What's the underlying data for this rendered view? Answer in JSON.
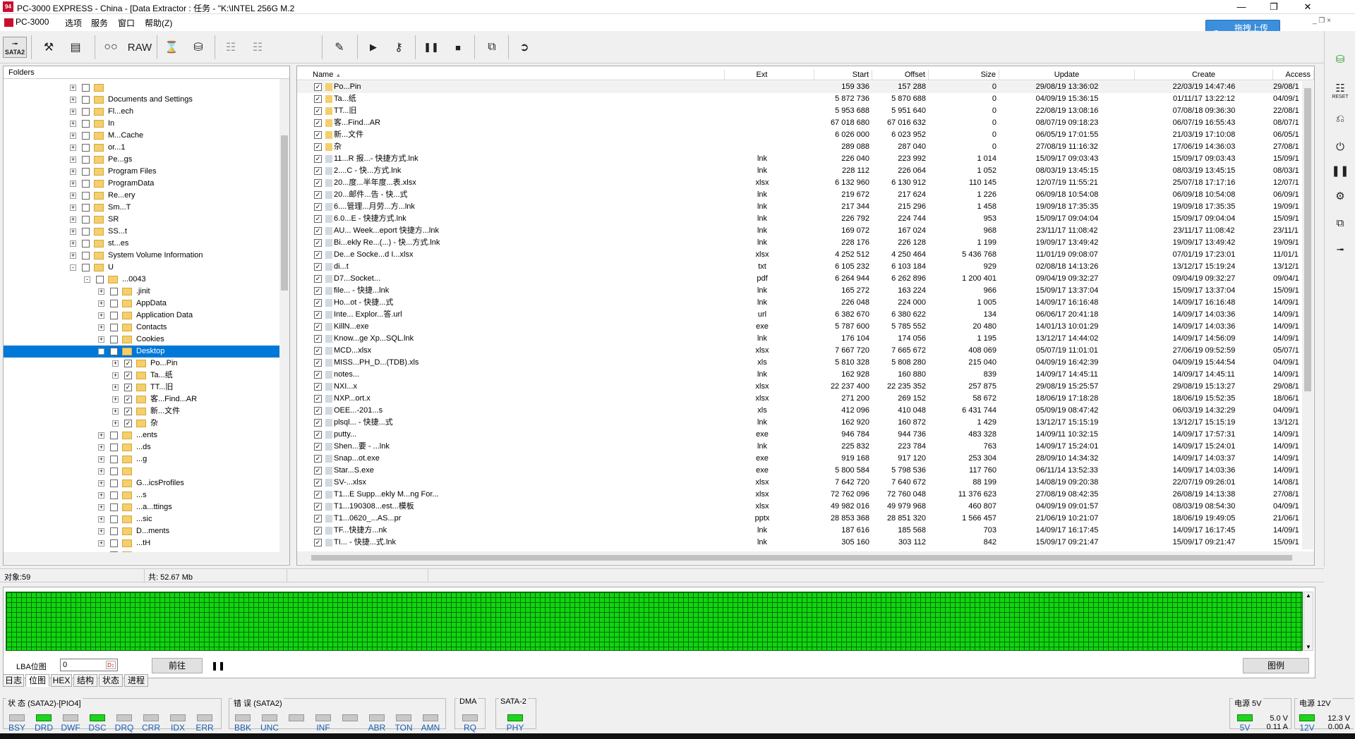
{
  "title": "PC-3000 EXPRESS - China - [Data Extractor : 任务 - \"K:\\INTEL 256G M.2",
  "app_icon_text": "94",
  "menu": [
    "PC-3000",
    "选项",
    "服务",
    "窗口",
    "帮助(Z)"
  ],
  "toolbar": {
    "sata_label": "SATA2",
    "raw_label": "RAW"
  },
  "upload": {
    "label": "拖拽上传"
  },
  "folders": {
    "header": "Folders",
    "rows": [
      {
        "depth": 0,
        "label": "",
        "checked": false,
        "expand": "+"
      },
      {
        "depth": 0,
        "label": "Documents and Settings",
        "checked": false,
        "expand": "+"
      },
      {
        "depth": 0,
        "label": "Fl...ech",
        "checked": false,
        "expand": "+"
      },
      {
        "depth": 0,
        "label": "In",
        "checked": false,
        "expand": "+"
      },
      {
        "depth": 0,
        "label": "M...Cache",
        "checked": false,
        "expand": "+"
      },
      {
        "depth": 0,
        "label": "or...1",
        "checked": false,
        "expand": "+"
      },
      {
        "depth": 0,
        "label": "Pe...gs",
        "checked": false,
        "expand": "+"
      },
      {
        "depth": 0,
        "label": "Program Files",
        "checked": false,
        "expand": "+"
      },
      {
        "depth": 0,
        "label": "ProgramData",
        "checked": false,
        "expand": "+"
      },
      {
        "depth": 0,
        "label": "Re...ery",
        "checked": false,
        "expand": "+"
      },
      {
        "depth": 0,
        "label": "Sm...T",
        "checked": false,
        "expand": "+"
      },
      {
        "depth": 0,
        "label": "SR",
        "checked": false,
        "expand": "+"
      },
      {
        "depth": 0,
        "label": "SS...t",
        "checked": false,
        "expand": "+"
      },
      {
        "depth": 0,
        "label": "st...es",
        "checked": false,
        "expand": "+"
      },
      {
        "depth": 0,
        "label": "System Volume Information",
        "checked": false,
        "expand": "+"
      },
      {
        "depth": 0,
        "label": "U",
        "checked": false,
        "expand": "-"
      },
      {
        "depth": 1,
        "label": "...0043",
        "checked": false,
        "expand": "-"
      },
      {
        "depth": 2,
        "label": ".jinit",
        "checked": false,
        "expand": "+"
      },
      {
        "depth": 2,
        "label": "AppData",
        "checked": false,
        "expand": "+"
      },
      {
        "depth": 2,
        "label": "Application Data",
        "checked": false,
        "expand": "+"
      },
      {
        "depth": 2,
        "label": "Contacts",
        "checked": false,
        "expand": "+"
      },
      {
        "depth": 2,
        "label": "Cookies",
        "checked": false,
        "expand": "+"
      },
      {
        "depth": 2,
        "label": "Desktop",
        "checked": true,
        "expand": "-",
        "selected": true
      },
      {
        "depth": 3,
        "label": "Po...Pin",
        "checked": true,
        "expand": "+"
      },
      {
        "depth": 3,
        "label": "Ta...纸",
        "checked": true,
        "expand": "+"
      },
      {
        "depth": 3,
        "label": "TT...旧",
        "checked": true,
        "expand": "+"
      },
      {
        "depth": 3,
        "label": "客...Find...AR",
        "checked": true,
        "expand": "+"
      },
      {
        "depth": 3,
        "label": "新...文件",
        "checked": true,
        "expand": "+"
      },
      {
        "depth": 3,
        "label": "杂",
        "checked": true,
        "expand": "+"
      },
      {
        "depth": 2,
        "label": "...ents",
        "checked": false,
        "expand": "+"
      },
      {
        "depth": 2,
        "label": "...ds",
        "checked": false,
        "expand": "+"
      },
      {
        "depth": 2,
        "label": "...g",
        "checked": false,
        "expand": "+"
      },
      {
        "depth": 2,
        "label": "",
        "checked": false,
        "expand": "+"
      },
      {
        "depth": 2,
        "label": "G...icsProfiles",
        "checked": false,
        "expand": "+"
      },
      {
        "depth": 2,
        "label": "...s",
        "checked": false,
        "expand": "+"
      },
      {
        "depth": 2,
        "label": "...a...ttings",
        "checked": false,
        "expand": "+"
      },
      {
        "depth": 2,
        "label": "...sic",
        "checked": false,
        "expand": "+"
      },
      {
        "depth": 2,
        "label": "D...ments",
        "checked": false,
        "expand": "+"
      },
      {
        "depth": 2,
        "label": "...tH",
        "checked": false,
        "expand": "+"
      },
      {
        "depth": 2,
        "label": "...ac",
        "checked": false,
        "expand": "+"
      }
    ]
  },
  "files": {
    "columns": {
      "name": "Name",
      "ext": "Ext",
      "start": "Start",
      "offset": "Offset",
      "size": "Size",
      "update": "Update",
      "create": "Create",
      "access": "Access"
    },
    "rows": [
      {
        "name": "Po...Pin",
        "ext": "",
        "start": "159 336",
        "offset": "157 288",
        "size": "0",
        "update": "29/08/19 13:36:02",
        "create": "22/03/19 14:47:46",
        "access": "29/08/1",
        "folder": true
      },
      {
        "name": "Ta...纸",
        "ext": "",
        "start": "5 872 736",
        "offset": "5 870 688",
        "size": "0",
        "update": "04/09/19 15:36:15",
        "create": "01/11/17 13:22:12",
        "access": "04/09/1",
        "folder": true
      },
      {
        "name": "TT...旧",
        "ext": "",
        "start": "5 953 688",
        "offset": "5 951 640",
        "size": "0",
        "update": "22/08/19 13:08:16",
        "create": "07/08/18 09:36:30",
        "access": "22/08/1",
        "folder": true
      },
      {
        "name": "客...Find...AR",
        "ext": "",
        "start": "67 018 680",
        "offset": "67 016 632",
        "size": "0",
        "update": "08/07/19 09:18:23",
        "create": "06/07/19 16:55:43",
        "access": "08/07/1",
        "folder": true
      },
      {
        "name": "新...文件",
        "ext": "",
        "start": "6 026 000",
        "offset": "6 023 952",
        "size": "0",
        "update": "06/05/19 17:01:55",
        "create": "21/03/19 17:10:08",
        "access": "06/05/1",
        "folder": true
      },
      {
        "name": "杂",
        "ext": "",
        "start": "289 088",
        "offset": "287 040",
        "size": "0",
        "update": "27/08/19 11:16:32",
        "create": "17/06/19 14:36:03",
        "access": "27/08/1",
        "folder": true
      },
      {
        "name": "11...R 报...- 快捷方式.lnk",
        "ext": "lnk",
        "start": "226 040",
        "offset": "223 992",
        "size": "1 014",
        "update": "15/09/17 09:03:43",
        "create": "15/09/17 09:03:43",
        "access": "15/09/1"
      },
      {
        "name": "2....C - 快...方式.lnk",
        "ext": "lnk",
        "start": "228 112",
        "offset": "226 064",
        "size": "1 052",
        "update": "08/03/19 13:45:15",
        "create": "08/03/19 13:45:15",
        "access": "08/03/1"
      },
      {
        "name": "20...度...半年度...表.xlsx",
        "ext": "xlsx",
        "start": "6 132 960",
        "offset": "6 130 912",
        "size": "110 145",
        "update": "12/07/19 11:55:21",
        "create": "25/07/18 17:17:16",
        "access": "12/07/1"
      },
      {
        "name": "20...邮件...告 - 快...式",
        "ext": "lnk",
        "start": "219 672",
        "offset": "217 624",
        "size": "1 226",
        "update": "06/09/18 10:54:08",
        "create": "06/09/18 10:54:08",
        "access": "06/09/1"
      },
      {
        "name": "6....管理...月劳...方...lnk",
        "ext": "lnk",
        "start": "217 344",
        "offset": "215 296",
        "size": "1 458",
        "update": "19/09/18 17:35:35",
        "create": "19/09/18 17:35:35",
        "access": "19/09/1"
      },
      {
        "name": "6.0...E - 快捷方式.lnk",
        "ext": "lnk",
        "start": "226 792",
        "offset": "224 744",
        "size": "953",
        "update": "15/09/17 09:04:04",
        "create": "15/09/17 09:04:04",
        "access": "15/09/1"
      },
      {
        "name": "AU... Week...eport 快捷方...lnk",
        "ext": "lnk",
        "start": "169 072",
        "offset": "167 024",
        "size": "968",
        "update": "23/11/17 11:08:42",
        "create": "23/11/17 11:08:42",
        "access": "23/11/1"
      },
      {
        "name": "Bi...ekly Re...(...) - 快...方式.lnk",
        "ext": "lnk",
        "start": "228 176",
        "offset": "226 128",
        "size": "1 199",
        "update": "19/09/17 13:49:42",
        "create": "19/09/17 13:49:42",
        "access": "19/09/1"
      },
      {
        "name": "De...e Socke...d I...xlsx",
        "ext": "xlsx",
        "start": "4 252 512",
        "offset": "4 250 464",
        "size": "5 436 768",
        "update": "11/01/19 09:08:07",
        "create": "07/01/19 17:23:01",
        "access": "11/01/1"
      },
      {
        "name": "di...t",
        "ext": "txt",
        "start": "6 105 232",
        "offset": "6 103 184",
        "size": "929",
        "update": "02/08/18 14:13:26",
        "create": "13/12/17 15:19:24",
        "access": "13/12/1"
      },
      {
        "name": "D7...Socket...",
        "ext": "pdf",
        "start": "6 264 944",
        "offset": "6 262 896",
        "size": "1 200 401",
        "update": "09/04/19 09:32:27",
        "create": "09/04/19 09:32:27",
        "access": "09/04/1"
      },
      {
        "name": "file... - 快捷...lnk",
        "ext": "lnk",
        "start": "165 272",
        "offset": "163 224",
        "size": "966",
        "update": "15/09/17 13:37:04",
        "create": "15/09/17 13:37:04",
        "access": "15/09/1"
      },
      {
        "name": "Ho...ot - 快捷...式",
        "ext": "lnk",
        "start": "226 048",
        "offset": "224 000",
        "size": "1 005",
        "update": "14/09/17 16:16:48",
        "create": "14/09/17 16:16:48",
        "access": "14/09/1"
      },
      {
        "name": "Inte... Explor...答.url",
        "ext": "url",
        "start": "6 382 670",
        "offset": "6 380 622",
        "size": "134",
        "update": "06/06/17 20:41:18",
        "create": "14/09/17 14:03:36",
        "access": "14/09/1"
      },
      {
        "name": "KillN...exe",
        "ext": "exe",
        "start": "5 787 600",
        "offset": "5 785 552",
        "size": "20 480",
        "update": "14/01/13 10:01:29",
        "create": "14/09/17 14:03:36",
        "access": "14/09/1"
      },
      {
        "name": "Know...ge Xp...SQL.lnk",
        "ext": "lnk",
        "start": "176 104",
        "offset": "174 056",
        "size": "1 195",
        "update": "13/12/17 14:44:02",
        "create": "14/09/17 14:56:09",
        "access": "14/09/1"
      },
      {
        "name": "MCD...xlsx",
        "ext": "xlsx",
        "start": "7 667 720",
        "offset": "7 665 672",
        "size": "408 069",
        "update": "05/07/19 11:01:01",
        "create": "27/06/19 09:52:59",
        "access": "05/07/1"
      },
      {
        "name": "MISS...PH_D...(TDB).xls",
        "ext": "xls",
        "start": "5 810 328",
        "offset": "5 808 280",
        "size": "215 040",
        "update": "04/09/19 16:42:39",
        "create": "04/09/19 15:44:54",
        "access": "04/09/1"
      },
      {
        "name": "notes...",
        "ext": "lnk",
        "start": "162 928",
        "offset": "160 880",
        "size": "839",
        "update": "14/09/17 14:45:11",
        "create": "14/09/17 14:45:11",
        "access": "14/09/1"
      },
      {
        "name": "NXI...x",
        "ext": "xlsx",
        "start": "22 237 400",
        "offset": "22 235 352",
        "size": "257 875",
        "update": "29/08/19 15:25:57",
        "create": "29/08/19 15:13:27",
        "access": "29/08/1"
      },
      {
        "name": "NXP...ort.x",
        "ext": "xlsx",
        "start": "271 200",
        "offset": "269 152",
        "size": "58 672",
        "update": "18/06/19 17:18:28",
        "create": "18/06/19 15:52:35",
        "access": "18/06/1"
      },
      {
        "name": "OEE...-201...s",
        "ext": "xls",
        "start": "412 096",
        "offset": "410 048",
        "size": "6 431 744",
        "update": "05/09/19 08:47:42",
        "create": "06/03/19 14:32:29",
        "access": "04/09/1"
      },
      {
        "name": "plsql... - 快捷...式",
        "ext": "lnk",
        "start": "162 920",
        "offset": "160 872",
        "size": "1 429",
        "update": "13/12/17 15:15:19",
        "create": "13/12/17 15:15:19",
        "access": "13/12/1"
      },
      {
        "name": "putty...",
        "ext": "exe",
        "start": "946 784",
        "offset": "944 736",
        "size": "483 328",
        "update": "14/09/11 10:32:15",
        "create": "14/09/17 17:57:31",
        "access": "14/09/1"
      },
      {
        "name": "Shen...要 - ...lnk",
        "ext": "lnk",
        "start": "225 832",
        "offset": "223 784",
        "size": "763",
        "update": "14/09/17 15:24:01",
        "create": "14/09/17 15:24:01",
        "access": "14/09/1"
      },
      {
        "name": "Snap...ot.exe",
        "ext": "exe",
        "start": "919 168",
        "offset": "917 120",
        "size": "253 304",
        "update": "28/09/10 14:34:32",
        "create": "14/09/17 14:03:37",
        "access": "14/09/1"
      },
      {
        "name": "Star...S.exe",
        "ext": "exe",
        "start": "5 800 584",
        "offset": "5 798 536",
        "size": "117 760",
        "update": "06/11/14 13:52:33",
        "create": "14/09/17 14:03:36",
        "access": "14/09/1"
      },
      {
        "name": "SV-...xlsx",
        "ext": "xlsx",
        "start": "7 642 720",
        "offset": "7 640 672",
        "size": "88 199",
        "update": "14/08/19 09:20:38",
        "create": "22/07/19 09:26:01",
        "access": "14/08/1"
      },
      {
        "name": "T1...E Supp...ekly M...ng For...",
        "ext": "xlsx",
        "start": "72 762 096",
        "offset": "72 760 048",
        "size": "11 376 623",
        "update": "27/08/19 08:42:35",
        "create": "26/08/19 14:13:38",
        "access": "27/08/1"
      },
      {
        "name": "T1...190308...est...模板",
        "ext": "xlsx",
        "start": "49 982 016",
        "offset": "49 979 968",
        "size": "460 807",
        "update": "04/09/19 09:01:57",
        "create": "08/03/19 08:54:30",
        "access": "04/09/1"
      },
      {
        "name": "T1...0620_...AS...pr",
        "ext": "pptx",
        "start": "28 853 368",
        "offset": "28 851 320",
        "size": "1 566 457",
        "update": "21/06/19 10:21:07",
        "create": "18/06/19 19:49:05",
        "access": "21/06/1"
      },
      {
        "name": "TF...快捷方...nk",
        "ext": "lnk",
        "start": "187 616",
        "offset": "185 568",
        "size": "703",
        "update": "14/09/17 16:17:45",
        "create": "14/09/17 16:17:45",
        "access": "14/09/1"
      },
      {
        "name": "TI... - 快捷...式.lnk",
        "ext": "lnk",
        "start": "305 160",
        "offset": "303 112",
        "size": "842",
        "update": "15/09/17 09:21:47",
        "create": "15/09/17 09:21:47",
        "access": "15/09/1"
      }
    ]
  },
  "status": {
    "objects": "对象:59",
    "total": "共: 52.67 Mb"
  },
  "lba": {
    "label": "LBA位图",
    "value": "0",
    "go_button": "前往",
    "legend_button": "图例"
  },
  "tabs": [
    {
      "label": "日志",
      "active": false
    },
    {
      "label": "位图",
      "active": true
    },
    {
      "label": "HEX",
      "active": false
    },
    {
      "label": "结构",
      "active": false
    },
    {
      "label": "状态",
      "active": false
    },
    {
      "label": "进程",
      "active": false
    }
  ],
  "indicators": {
    "state_title": "状 态 (SATA2)-[PIO4]",
    "state_leds": [
      {
        "label": "BSY",
        "on": false
      },
      {
        "label": "DRD",
        "on": true
      },
      {
        "label": "DWF",
        "on": false
      },
      {
        "label": "DSC",
        "on": true
      },
      {
        "label": "DRQ",
        "on": false
      },
      {
        "label": "CRR",
        "on": false
      },
      {
        "label": "IDX",
        "on": false
      },
      {
        "label": "ERR",
        "on": false
      }
    ],
    "error_title": "错 误 (SATA2)",
    "error_leds": [
      {
        "label": "BBK",
        "on": false
      },
      {
        "label": "UNC",
        "on": false
      },
      {
        "label": "",
        "on": false
      },
      {
        "label": "INF",
        "on": false
      },
      {
        "label": "",
        "on": false
      },
      {
        "label": "ABR",
        "on": false
      },
      {
        "label": "TON",
        "on": false
      },
      {
        "label": "AMN",
        "on": false
      }
    ],
    "dma_title": "DMA",
    "dma_leds": [
      {
        "label": "RQ",
        "on": false
      }
    ],
    "sata_title": "SATA-2",
    "sata_leds": [
      {
        "label": "PHY",
        "on": true
      }
    ],
    "power5_title": "电源 5V",
    "power5_label": "5V",
    "power5_voltage": "5.0 V",
    "power5_current": "0.11 A",
    "power12_title": "电源 12V",
    "power12_label": "12V",
    "power12_voltage": "12.3 V",
    "power12_current": "0.00 A"
  },
  "colors": {
    "selection": "#0078d7",
    "led_on": "#1ed41e",
    "map_green": "#0fd60f",
    "upload_blue": "#3b8fdc"
  }
}
